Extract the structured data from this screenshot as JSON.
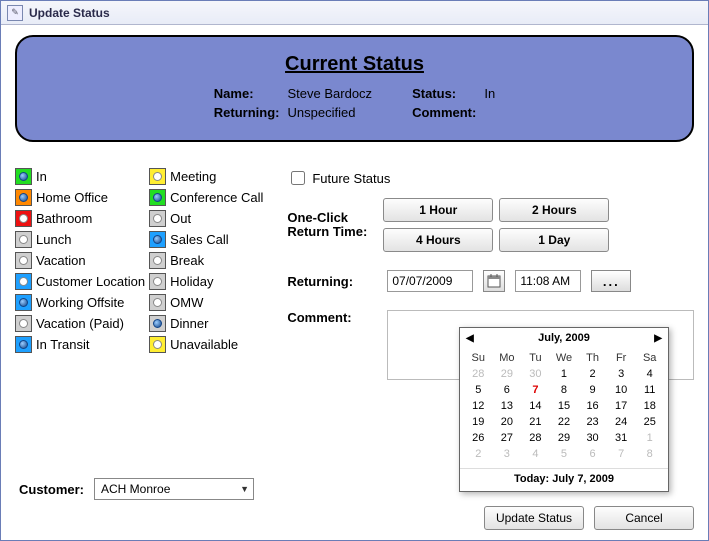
{
  "window": {
    "title": "Update Status"
  },
  "current": {
    "heading": "Current Status",
    "name_label": "Name:",
    "name_value": "Steve Bardocz",
    "status_label": "Status:",
    "status_value": "In",
    "returning_label": "Returning:",
    "returning_value": "Unspecified",
    "comment_label": "Comment:",
    "comment_value": ""
  },
  "statuses_left": [
    {
      "label": "In",
      "color": "green",
      "selected": true
    },
    {
      "label": "Home Office",
      "color": "orange",
      "selected": true
    },
    {
      "label": "Bathroom",
      "color": "red",
      "selected": false
    },
    {
      "label": "Lunch",
      "color": "gray",
      "selected": false
    },
    {
      "label": "Vacation",
      "color": "gray",
      "selected": false
    },
    {
      "label": "Customer Location",
      "color": "blue",
      "selected": false
    },
    {
      "label": "Working Offsite",
      "color": "blue",
      "selected": true
    },
    {
      "label": "Vacation (Paid)",
      "color": "gray",
      "selected": false
    },
    {
      "label": "In Transit",
      "color": "blue",
      "selected": true
    }
  ],
  "statuses_right": [
    {
      "label": "Meeting",
      "color": "yellow",
      "selected": false
    },
    {
      "label": "Conference Call",
      "color": "green",
      "selected": true
    },
    {
      "label": "Out",
      "color": "gray",
      "selected": false
    },
    {
      "label": "Sales Call",
      "color": "blue",
      "selected": true
    },
    {
      "label": "Break",
      "color": "gray",
      "selected": false
    },
    {
      "label": "Holiday",
      "color": "gray",
      "selected": false
    },
    {
      "label": "OMW",
      "color": "gray",
      "selected": false
    },
    {
      "label": "Dinner",
      "color": "gray",
      "selected": true
    },
    {
      "label": "Unavailable",
      "color": "yellow",
      "selected": false
    }
  ],
  "future_label": "Future Status",
  "oneclick_label": "One-Click Return Time:",
  "oneclick_buttons": [
    "1 Hour",
    "2 Hours",
    "4 Hours",
    "1 Day"
  ],
  "returning": {
    "label": "Returning:",
    "date": "07/07/2009",
    "time": "11:08 AM",
    "dots": "..."
  },
  "comment_label": "Comment:",
  "customer": {
    "label": "Customer:",
    "value": "ACH Monroe"
  },
  "actions": {
    "update": "Update Status",
    "cancel": "Cancel"
  },
  "calendar": {
    "title": "July, 2009",
    "dows": [
      "Su",
      "Mo",
      "Tu",
      "We",
      "Th",
      "Fr",
      "Sa"
    ],
    "cells": [
      {
        "d": "28",
        "off": true
      },
      {
        "d": "29",
        "off": true
      },
      {
        "d": "30",
        "off": true
      },
      {
        "d": "1"
      },
      {
        "d": "2"
      },
      {
        "d": "3"
      },
      {
        "d": "4"
      },
      {
        "d": "5"
      },
      {
        "d": "6"
      },
      {
        "d": "7",
        "today": true
      },
      {
        "d": "8"
      },
      {
        "d": "9"
      },
      {
        "d": "10"
      },
      {
        "d": "11"
      },
      {
        "d": "12"
      },
      {
        "d": "13"
      },
      {
        "d": "14"
      },
      {
        "d": "15"
      },
      {
        "d": "16"
      },
      {
        "d": "17"
      },
      {
        "d": "18"
      },
      {
        "d": "19"
      },
      {
        "d": "20"
      },
      {
        "d": "21"
      },
      {
        "d": "22"
      },
      {
        "d": "23"
      },
      {
        "d": "24"
      },
      {
        "d": "25"
      },
      {
        "d": "26"
      },
      {
        "d": "27"
      },
      {
        "d": "28"
      },
      {
        "d": "29"
      },
      {
        "d": "30"
      },
      {
        "d": "31"
      },
      {
        "d": "1",
        "off": true
      },
      {
        "d": "2",
        "off": true
      },
      {
        "d": "3",
        "off": true
      },
      {
        "d": "4",
        "off": true
      },
      {
        "d": "5",
        "off": true
      },
      {
        "d": "6",
        "off": true
      },
      {
        "d": "7",
        "off": true
      },
      {
        "d": "8",
        "off": true
      }
    ],
    "footer": "Today: July 7, 2009"
  }
}
